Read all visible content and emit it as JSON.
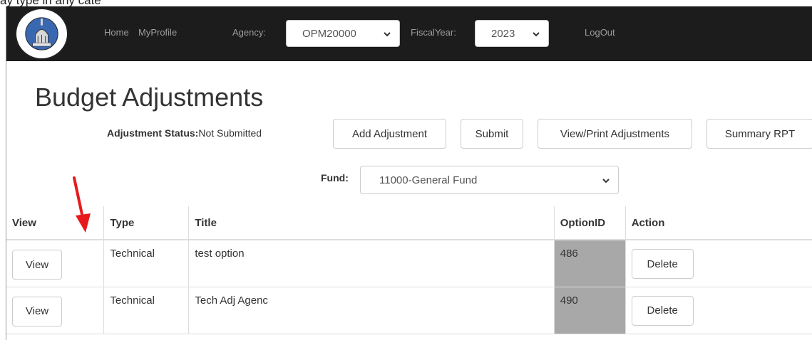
{
  "caption": "ay type in any cate",
  "nav": {
    "home": "Home",
    "my_profile": "MyProfile",
    "agency_label": "Agency:",
    "agency_value": "OPM20000",
    "fiscal_label": "FiscalYear:",
    "fiscal_value": "2023",
    "logout": "LogOut"
  },
  "page_title": "Budget Adjustments",
  "status": {
    "label": "Adjustment Status:",
    "value": "Not Submitted"
  },
  "buttons": {
    "add": "Add Adjustment",
    "submit": "Submit",
    "view_print": "View/Print Adjustments",
    "summary": "Summary RPT"
  },
  "fund": {
    "label": "Fund:",
    "value": "11000-General Fund"
  },
  "table": {
    "headers": [
      "View",
      "Type",
      "Title",
      "OptionID",
      "Action"
    ],
    "rows": [
      {
        "view": "View",
        "type": "Technical",
        "title": "test option",
        "option_id": "486",
        "action": "Delete"
      },
      {
        "view": "View",
        "type": "Technical",
        "title": "Tech Adj Agenc",
        "option_id": "490",
        "action": "Delete"
      }
    ]
  },
  "colors": {
    "navbar": "#1c1c1c",
    "nav_link": "#9d9d9d",
    "option_cell": "#a8a8a8",
    "annotation_arrow": "#e8191b"
  },
  "icons": {
    "logo": "connecticut-opm-seal",
    "dropdown": "chevron-down-icon",
    "annotation": "red-arrow"
  }
}
